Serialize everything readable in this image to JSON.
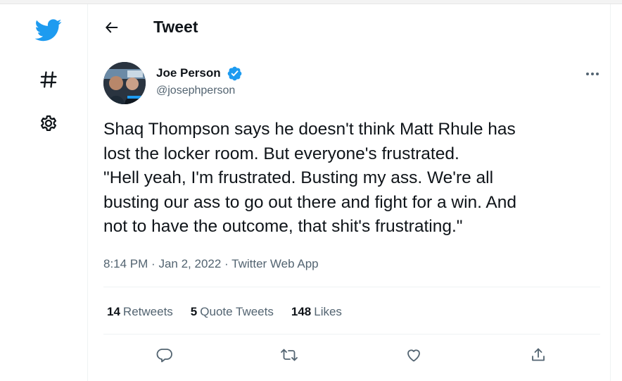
{
  "header": {
    "title": "Tweet"
  },
  "nav": {
    "icons": [
      "twitter-logo-icon",
      "hashtag-icon",
      "gear-icon"
    ],
    "brand_color": "#1d9bf0"
  },
  "tweet": {
    "author": {
      "name": "Joe Person",
      "handle": "@josephperson",
      "verified": true
    },
    "text": "Shaq Thompson says he doesn't think Matt Rhule has\nlost the locker room. But everyone's frustrated.\n\"Hell yeah, I'm frustrated. Busting my ass. We're all\nbusting our ass to go out there and fight for a win. And\nnot to have the outcome, that shit's frustrating.\"",
    "time": "8:14 PM",
    "date": "Jan 2, 2022",
    "separator": "·",
    "source": "Twitter Web App",
    "stats": {
      "retweets_count": "14",
      "retweets_label": "Retweets",
      "quotes_count": "5",
      "quotes_label": "Quote Tweets",
      "likes_count": "148",
      "likes_label": "Likes"
    }
  },
  "actions": [
    "reply-icon",
    "retweet-icon",
    "like-icon",
    "share-icon"
  ],
  "colors": {
    "text_primary": "#0f1419",
    "text_secondary": "#536471",
    "divider": "#eff3f4",
    "accent": "#1d9bf0"
  }
}
